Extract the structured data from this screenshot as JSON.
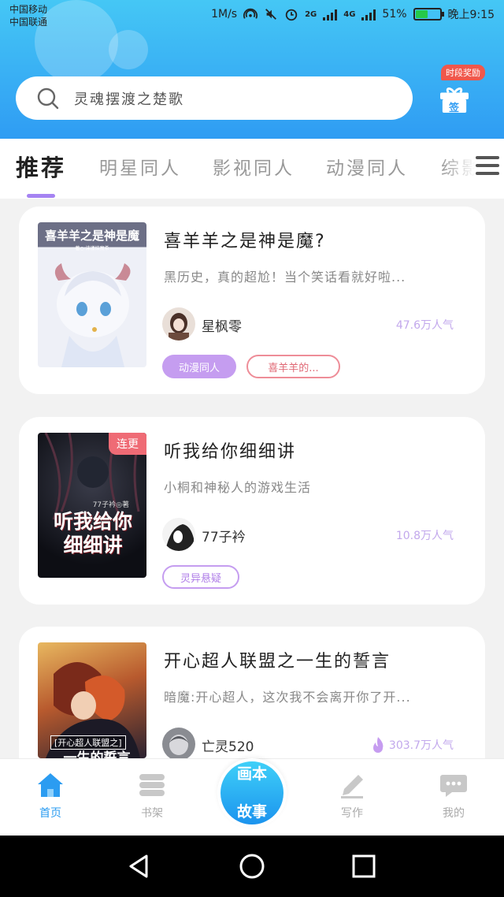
{
  "status_bar": {
    "carrier_1": "中国移动",
    "carrier_2": "中国联通",
    "speed": "1M/s",
    "net_2g": "2G",
    "net_4g": "4G",
    "battery": "51%",
    "time": "晚上9:15",
    "battery_level": 0.51,
    "battery_color": "#25c94a"
  },
  "search": {
    "placeholder": "灵魂摆渡之楚歌"
  },
  "gift": {
    "badge": "时段奖励",
    "label": "签"
  },
  "tabs": [
    {
      "label": "推荐",
      "active": true
    },
    {
      "label": "明星同人"
    },
    {
      "label": "影视同人"
    },
    {
      "label": "动漫同人"
    },
    {
      "label": "综影"
    }
  ],
  "books": [
    {
      "cover_title": "喜羊羊之是神是魔",
      "cover_sub": "著○ 沫漾炫魔希",
      "title": "喜羊羊之是神是魔?",
      "desc": "黑历史，真的超尬！当个笑话看就好啦...",
      "author": "星枫零",
      "popularity": "47.6万人气",
      "tags": [
        "动漫同人",
        "喜羊羊的..."
      ]
    },
    {
      "corner_tag": "连更",
      "cover_author": "77子衿◎著",
      "cover_title": "听我给你细细讲",
      "title": "听我给你细细讲",
      "desc": "小桐和神秘人的游戏生活",
      "author": "77子衿",
      "popularity": "10.8万人气",
      "tags": [
        "灵异悬疑"
      ]
    },
    {
      "cover_title": "[开心超人联盟之]",
      "cover_sub": "一生的誓言",
      "title": "开心超人联盟之一生的誓言",
      "desc": "暗魔:开心超人，这次我不会离开你了开...",
      "author": "亡灵520",
      "popularity": "303.7万人气",
      "tags": []
    }
  ],
  "bottom_nav": {
    "items": [
      {
        "label": "首页",
        "icon": "home-icon",
        "active": true
      },
      {
        "label": "书架",
        "icon": "bookshelf-icon"
      },
      {
        "label": "写作",
        "icon": "pen-icon"
      },
      {
        "label": "我的",
        "icon": "message-icon"
      }
    ],
    "center": {
      "line1": "画本",
      "line2": "故事"
    },
    "accent": "#2b9cf1"
  }
}
